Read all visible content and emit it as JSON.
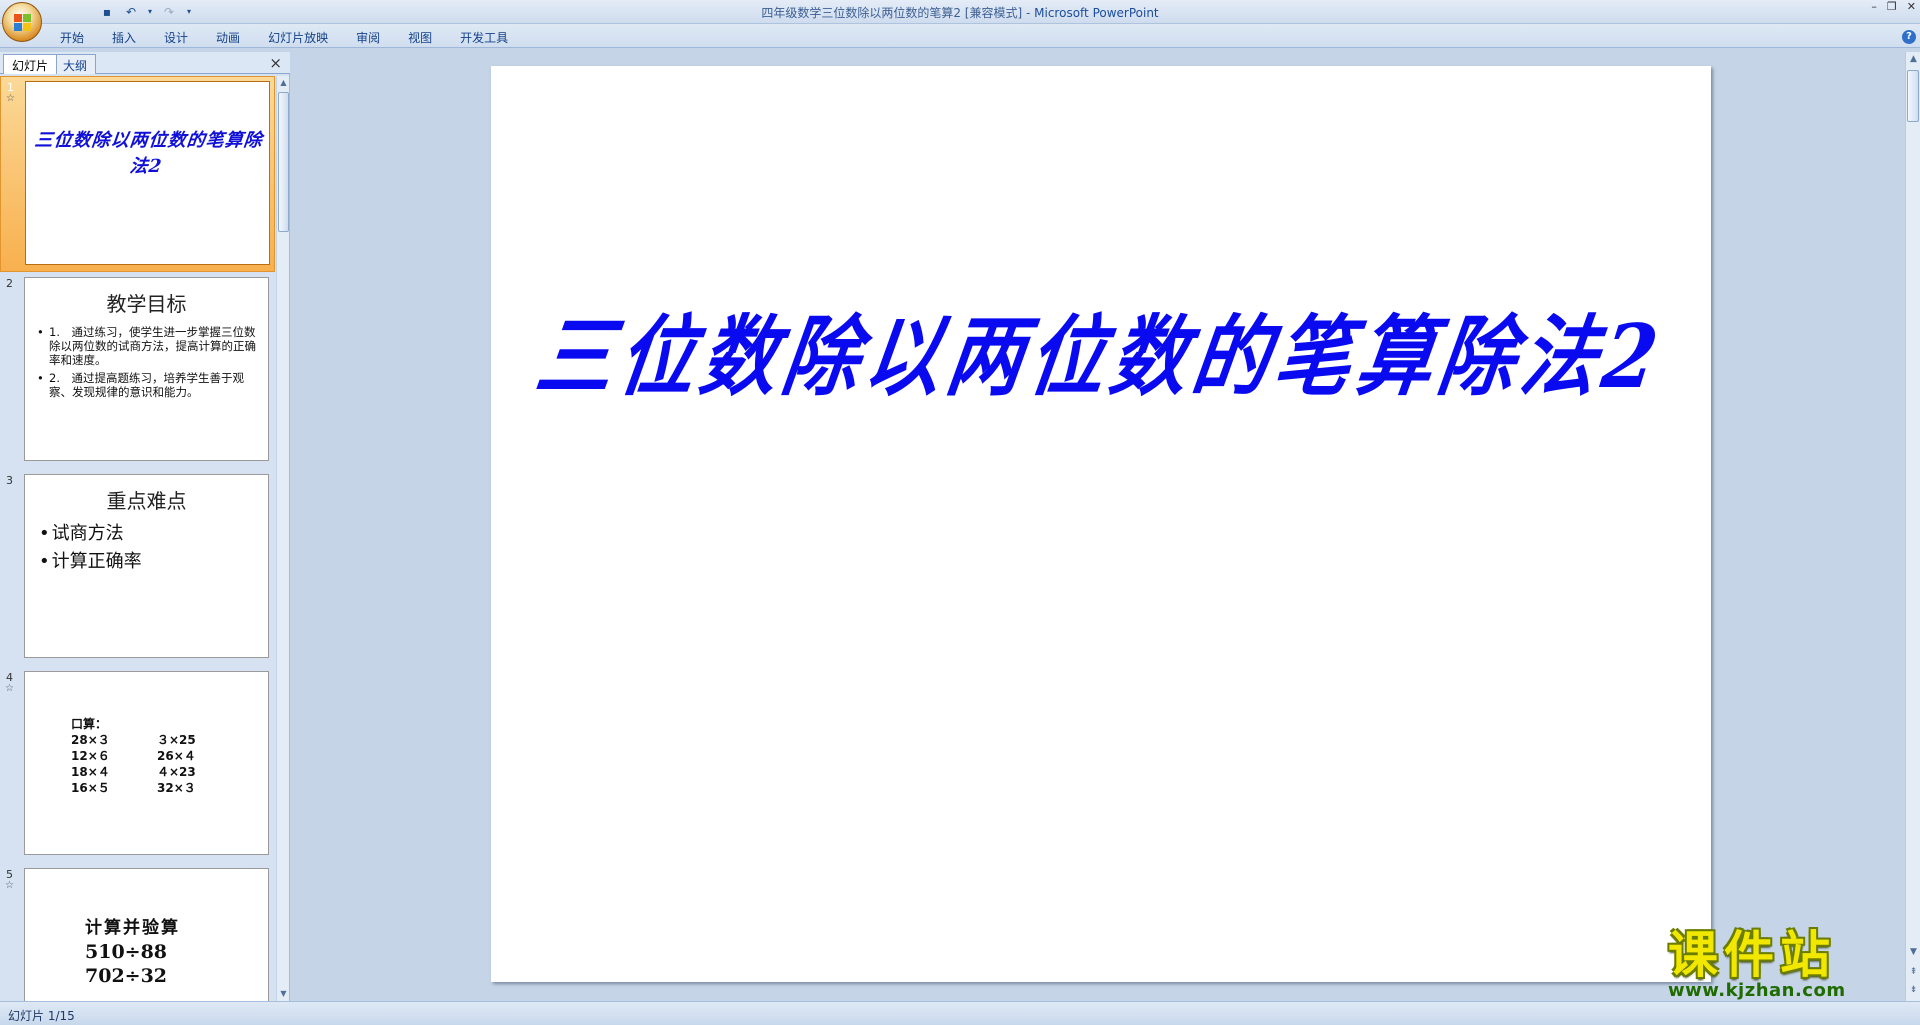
{
  "window": {
    "title": "四年级数学三位数除以两位数的笔算2 [兼容模式]",
    "separator": " - ",
    "app_name": "Microsoft PowerPoint"
  },
  "quick_access": {
    "save_icon": "save-icon",
    "undo_icon": "undo-icon",
    "redo_icon": "redo-icon",
    "customize_icon": "chevron-down-icon"
  },
  "ribbon": {
    "tabs": [
      "开始",
      "插入",
      "设计",
      "动画",
      "幻灯片放映",
      "审阅",
      "视图",
      "开发工具"
    ],
    "help_icon": "?"
  },
  "left_pane": {
    "tabs": {
      "slides": "幻灯片",
      "outline": "大纲"
    },
    "close": "×",
    "thumbnails": [
      {
        "num": "1",
        "star": "☆",
        "title": "三位数除以两位数的笔算除法2"
      },
      {
        "num": "2",
        "heading": "教学目标",
        "bullets": [
          "1.　通过练习，使学生进一步掌握三位数除以两位数的试商方法，提高计算的正确率和速度。",
          "2.　通过提高题练习，培养学生善于观察、发现规律的意识和能力。"
        ]
      },
      {
        "num": "3",
        "heading": "重点难点",
        "bullets": [
          "试商方法",
          "计算正确率"
        ]
      },
      {
        "num": "4",
        "star": "☆",
        "label": "口算：",
        "rows": [
          [
            "28×３",
            "３×25"
          ],
          [
            "12×６",
            "26×４"
          ],
          [
            "18×４",
            "４×23"
          ],
          [
            "16×５",
            "32×３"
          ]
        ]
      },
      {
        "num": "5",
        "star": "☆",
        "heading": "计算并验算",
        "lines": [
          "510÷88",
          "702÷32"
        ]
      }
    ]
  },
  "slide": {
    "title": "三位数除以两位数的笔算除法2"
  },
  "watermark": {
    "cn": "课件站",
    "url": "www.kjzhan.com"
  },
  "status": {
    "slide_counter": "幻灯片 1/15"
  },
  "window_controls": {
    "minimize": "–",
    "restore": "❐",
    "close": "✕"
  }
}
